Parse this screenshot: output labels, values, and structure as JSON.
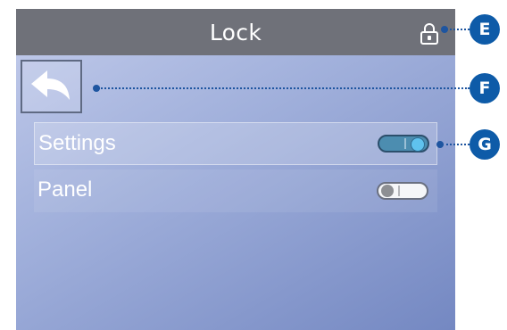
{
  "header": {
    "title": "Lock",
    "icon": "padlock-icon"
  },
  "back": {
    "icon": "back-arrow-icon"
  },
  "rows": [
    {
      "label": "Settings",
      "toggle_on": true,
      "selected": true
    },
    {
      "label": "Panel",
      "toggle_on": false,
      "selected": false
    }
  ],
  "callouts": [
    {
      "label": "E"
    },
    {
      "label": "F"
    },
    {
      "label": "G"
    }
  ],
  "colors": {
    "accent": "#0e5ba8",
    "toggle_on": "#4c8db0",
    "titlebar": "#6f7179"
  }
}
